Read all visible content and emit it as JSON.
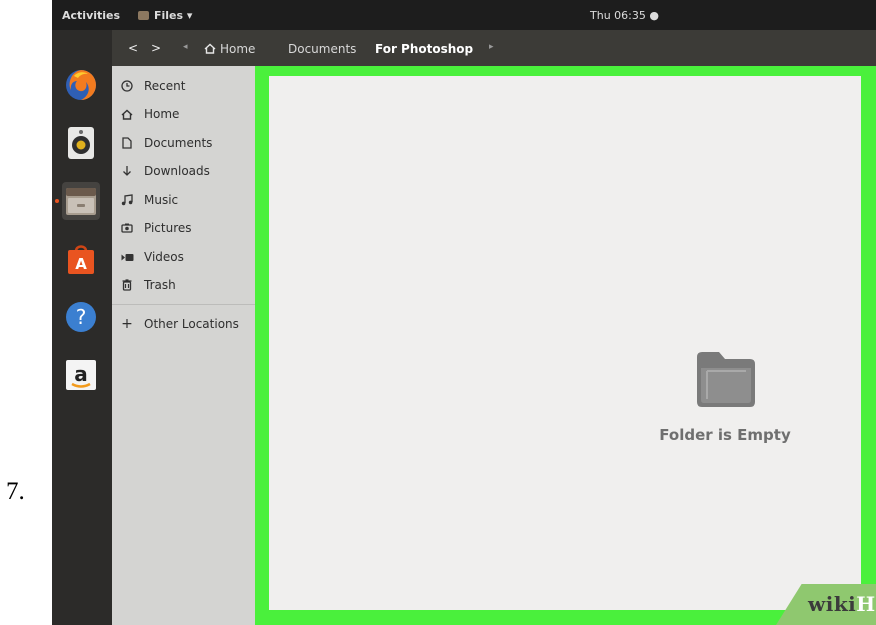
{
  "step": {
    "number": "7."
  },
  "topbar": {
    "activities": "Activities",
    "app_menu": "Files ▾",
    "clock": "Thu 06:35 ●"
  },
  "dock": {
    "items": [
      {
        "name": "Firefox",
        "icon": "firefox-icon"
      },
      {
        "name": "Rhythmbox",
        "icon": "speaker-icon"
      },
      {
        "name": "Files",
        "icon": "file-cabinet-icon"
      },
      {
        "name": "Ubuntu Software",
        "icon": "shopping-bag-icon"
      },
      {
        "name": "Help",
        "icon": "help-icon"
      },
      {
        "name": "Amazon",
        "icon": "amazon-icon"
      }
    ]
  },
  "headerbar": {
    "back": "<",
    "forward": ">",
    "path_left": "◂",
    "path_right": "▸",
    "crumbs": [
      {
        "label": "Home",
        "icon": "home-icon"
      },
      {
        "label": "Documents"
      },
      {
        "label": "For Photoshop"
      }
    ]
  },
  "sidebar": {
    "items": [
      {
        "label": "Recent",
        "icon": "clock-icon"
      },
      {
        "label": "Home",
        "icon": "home-icon"
      },
      {
        "label": "Documents",
        "icon": "document-icon"
      },
      {
        "label": "Downloads",
        "icon": "download-icon"
      },
      {
        "label": "Music",
        "icon": "music-icon"
      },
      {
        "label": "Pictures",
        "icon": "camera-icon"
      },
      {
        "label": "Videos",
        "icon": "video-icon"
      },
      {
        "label": "Trash",
        "icon": "trash-icon"
      }
    ],
    "other_locations": {
      "label": "Other Locations",
      "icon": "plus-icon"
    }
  },
  "content": {
    "empty_message": "Folder is Empty",
    "icon": "folder-icon"
  },
  "watermark": {
    "wiki": "wiki",
    "how": "How"
  },
  "colors": {
    "highlight_frame": "#4af03c",
    "accent": "#e95420",
    "headerbar": "#3c3b37",
    "sidebar": "#d4d4d2",
    "content": "#f0efee",
    "watermark": "#8fc86f"
  }
}
